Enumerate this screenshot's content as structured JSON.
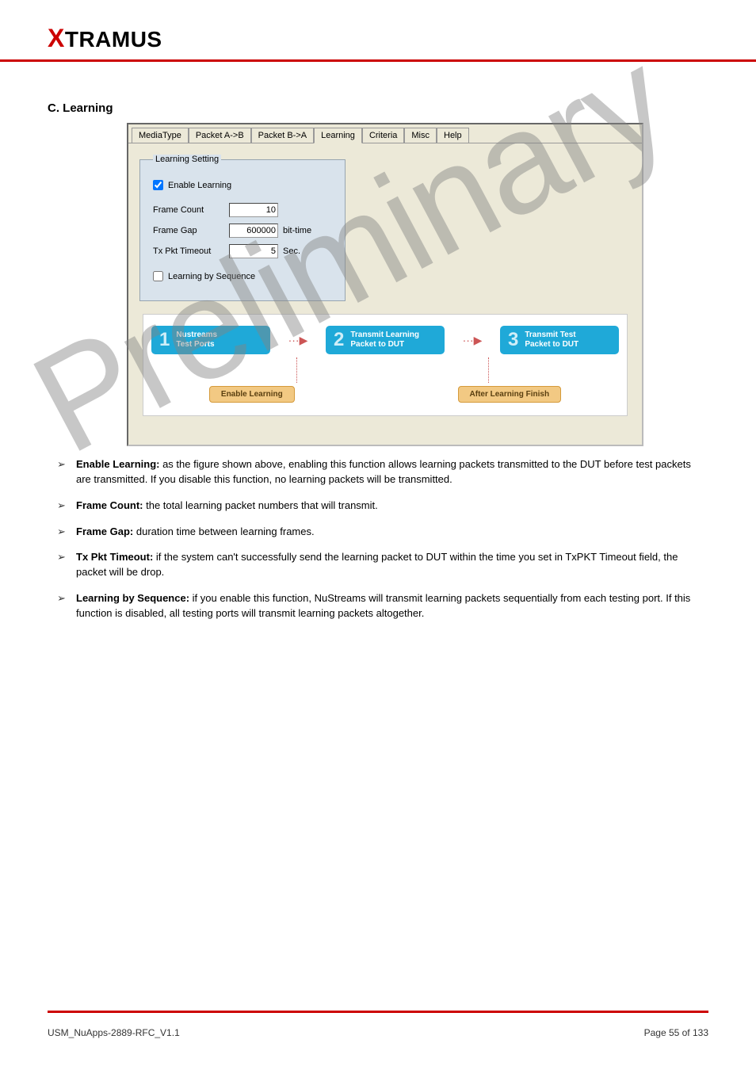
{
  "logo": {
    "x": "X",
    "rest": "TRAMUS"
  },
  "section_title": "C. Learning",
  "tabs": [
    "MediaType",
    "Packet A->B",
    "Packet B->A",
    "Learning",
    "Criteria",
    "Misc",
    "Help"
  ],
  "active_tab_index": 3,
  "learning": {
    "legend": "Learning Setting",
    "enable_label": "Enable Learning",
    "enable_checked": true,
    "frame_count_label": "Frame Count",
    "frame_count_value": "10",
    "frame_gap_label": "Frame Gap",
    "frame_gap_value": "600000",
    "frame_gap_unit": "bit-time",
    "tx_timeout_label": "Tx Pkt Timeout",
    "tx_timeout_value": "5",
    "tx_timeout_unit": "Sec.",
    "seq_label": "Learning by Sequence",
    "seq_checked": false
  },
  "diagram": {
    "box1_num": "1",
    "box1_line1": "Nustreams",
    "box1_line2": "Test Ports",
    "box2_num": "2",
    "box2_line1": "Transmit Learning",
    "box2_line2": "Packet to DUT",
    "box3_num": "3",
    "box3_line1": "Transmit Test",
    "box3_line2": "Packet to DUT",
    "pill1": "Enable Learning",
    "pill2": "After Learning Finish"
  },
  "bullets": [
    {
      "b": "Enable Learning:",
      "t": " as the figure shown above, enabling this function allows learning packets transmitted to the DUT before test packets are transmitted. If you disable this function, no learning packets will be transmitted."
    },
    {
      "b": "Frame Count:",
      "t": " the total learning packet numbers that will transmit."
    },
    {
      "b": "Frame Gap:",
      "t": " duration time between learning frames."
    },
    {
      "b": "Tx Pkt Timeout:",
      "t": " if the system can't successfully send the learning packet to DUT within the time you set in TxPKT Timeout field, the packet will be drop."
    },
    {
      "b": "Learning by Sequence:",
      "t": " if you enable this function, NuStreams will transmit learning packets sequentially from each testing port. If this function is disabled, all testing ports will transmit learning packets altogether."
    }
  ],
  "watermark": "Preliminary",
  "footer": {
    "left": "USM_NuApps-2889-RFC_V1.1",
    "right": "Page 55 of 133"
  }
}
